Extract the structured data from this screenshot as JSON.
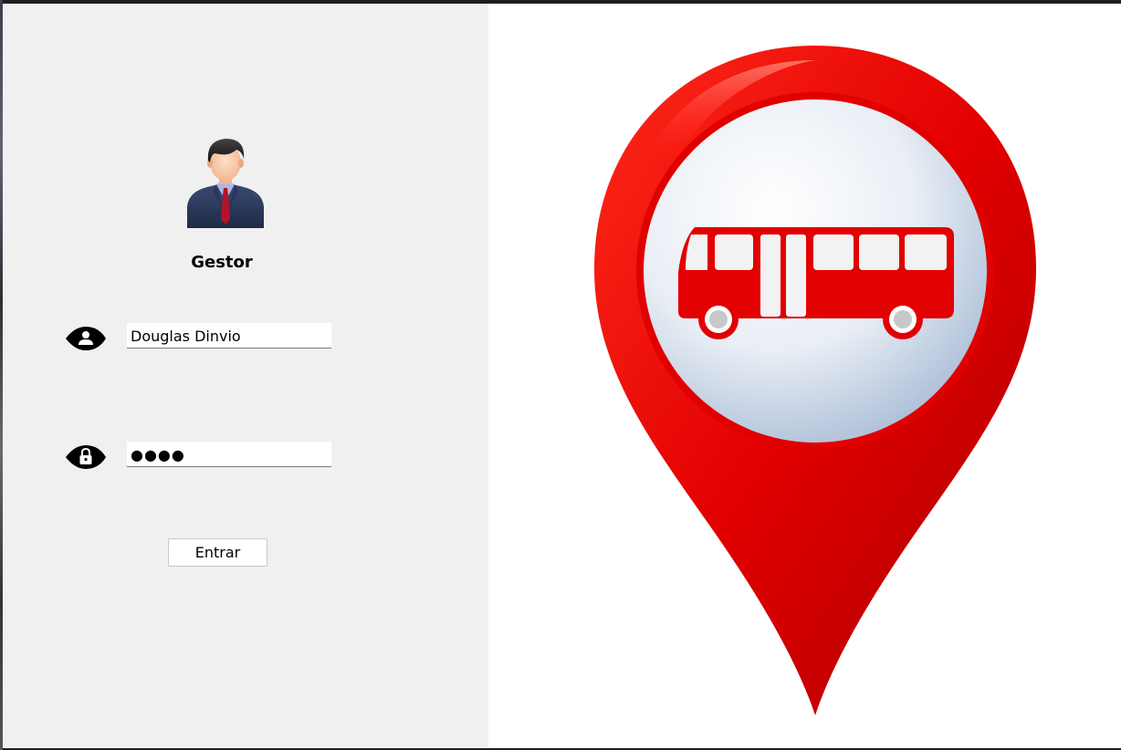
{
  "login": {
    "role_label": "Gestor",
    "username_value": "Douglas Dinvio",
    "password_display": "●●●●",
    "submit_label": "Entrar"
  },
  "icons": {
    "avatar": "businessman-avatar-icon",
    "username": "user-icon",
    "password": "lock-icon",
    "illustration": "bus-location-pin-icon"
  },
  "colors": {
    "left_panel_bg": "#f0f0f0",
    "pin_red": "#e60000",
    "bus_red": "#e00000"
  }
}
